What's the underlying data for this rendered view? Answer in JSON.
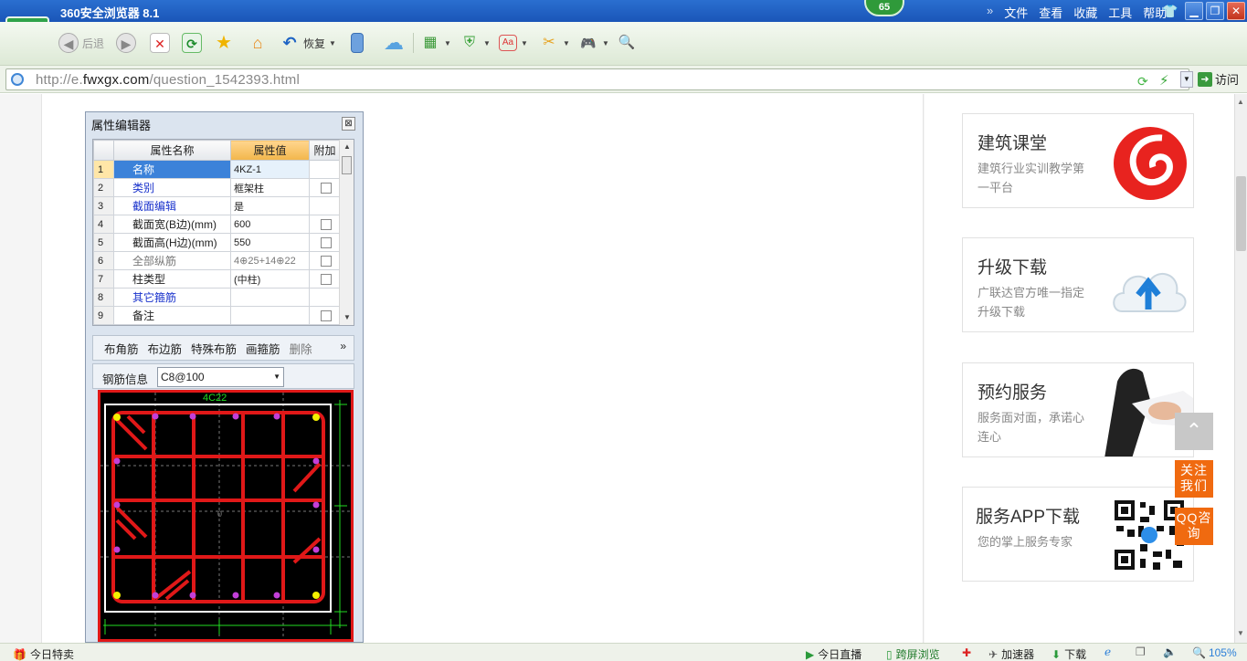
{
  "browser": {
    "title": "360安全浏览器 8.1",
    "badge": "65",
    "menu": [
      "文件",
      "查看",
      "收藏",
      "工具",
      "帮助"
    ],
    "menu_chevron": "»"
  },
  "toolbar": {
    "back_label": "后退",
    "restore_label": "恢复"
  },
  "address": {
    "url_prefix": "http://e.",
    "url_domain": "fwxgx.com",
    "url_path": "/question_1542393.html",
    "go_label": "访问"
  },
  "prop_editor": {
    "title": "属性编辑器",
    "headers": [
      "属性名称",
      "属性值",
      "附加"
    ],
    "rows": [
      {
        "num": "1",
        "name": "名称",
        "value": "4KZ-1",
        "check": false,
        "style": "sel"
      },
      {
        "num": "2",
        "name": "类别",
        "value": "框架柱",
        "check": true,
        "style": "blue"
      },
      {
        "num": "3",
        "name": "截面编辑",
        "value": "是",
        "check": false,
        "style": "blue"
      },
      {
        "num": "4",
        "name": "截面宽(B边)(mm)",
        "value": "600",
        "check": true,
        "style": ""
      },
      {
        "num": "5",
        "name": "截面高(H边)(mm)",
        "value": "550",
        "check": true,
        "style": ""
      },
      {
        "num": "6",
        "name": "全部纵筋",
        "value": "4⊕25+14⊕22",
        "check": true,
        "style": "gray"
      },
      {
        "num": "7",
        "name": "柱类型",
        "value": "(中柱)",
        "check": true,
        "style": ""
      },
      {
        "num": "8",
        "name": "其它箍筋",
        "value": "",
        "check": false,
        "style": "blue"
      },
      {
        "num": "9",
        "name": "备注",
        "value": "",
        "check": true,
        "style": ""
      }
    ],
    "rebar_tools": [
      "布角筋",
      "布边筋",
      "特殊布筋",
      "画箍筋",
      "删除"
    ],
    "rebar_info_label": "钢筋信息",
    "rebar_info_value": "C8@100",
    "canvas_label_top": "4C22",
    "canvas_center": "0"
  },
  "sidebar": {
    "cards": [
      {
        "title": "建筑课堂",
        "desc": "建筑行业实训教学第一平台",
        "icon": "spiral-logo-icon"
      },
      {
        "title": "升级下载",
        "desc": "广联达官方唯一指定升级下载",
        "icon": "cloud-upload-icon"
      },
      {
        "title": "预约服务",
        "desc": "服务面对面，承诺心连心",
        "icon": "handshake-photo"
      },
      {
        "title": "服务APP下载",
        "desc": "您的掌上服务专家",
        "icon": "qr-code-icon"
      }
    ],
    "float_buttons": [
      "关注我们",
      "QQ咨询"
    ]
  },
  "statusbar": {
    "left": "今日特卖",
    "items": [
      "今日直播",
      "跨屏浏览",
      "加速器",
      "下载"
    ],
    "zoom": "105%"
  },
  "colors": {
    "title_blue": "#1a55b8",
    "logo_green": "#2fa34a",
    "float_orange": "#f06a10",
    "rebar_red": "#e01818",
    "grid_green": "#22dd22"
  }
}
